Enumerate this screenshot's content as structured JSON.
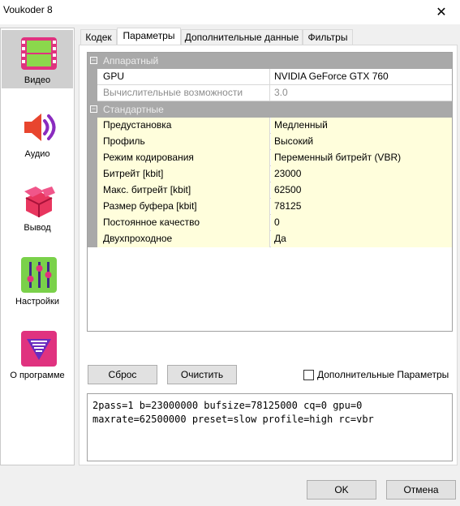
{
  "window": {
    "title": "Voukoder 8",
    "close_glyph": "✕"
  },
  "sidebar": {
    "items": [
      {
        "label": "Видео",
        "icon": "film-strip-icon",
        "active": true
      },
      {
        "label": "Аудио",
        "icon": "speaker-icon",
        "active": false
      },
      {
        "label": "Вывод",
        "icon": "package-box-icon",
        "active": false
      },
      {
        "label": "Настройки",
        "icon": "sliders-icon",
        "active": false
      },
      {
        "label": "О программе",
        "icon": "voukoder-logo-icon",
        "active": false
      }
    ]
  },
  "tabs": [
    {
      "label": "Кодек",
      "active": false
    },
    {
      "label": "Параметры",
      "active": true
    },
    {
      "label": "Дополнительные данные",
      "active": false
    },
    {
      "label": "Фильтры",
      "active": false
    }
  ],
  "property_grid": {
    "categories": [
      {
        "name": "Аппаратный",
        "toggle": "−",
        "rows": [
          {
            "name": "GPU",
            "value": "NVIDIA GeForce GTX 760",
            "highlight": false,
            "disabled": false
          },
          {
            "name": "Вычислительные возможности",
            "value": "3.0",
            "highlight": false,
            "disabled": true
          }
        ]
      },
      {
        "name": "Стандартные",
        "toggle": "−",
        "rows": [
          {
            "name": "Предустановка",
            "value": "Медленный",
            "highlight": true,
            "disabled": false
          },
          {
            "name": "Профиль",
            "value": "Высокий",
            "highlight": true,
            "disabled": false
          },
          {
            "name": "Режим кодирования",
            "value": "Переменный битрейт (VBR)",
            "highlight": true,
            "disabled": false
          },
          {
            "name": "Битрейт [kbit]",
            "value": "23000",
            "highlight": true,
            "disabled": false
          },
          {
            "name": "Макс. битрейт [kbit]",
            "value": "62500",
            "highlight": true,
            "disabled": false
          },
          {
            "name": "Размер буфера [kbit]",
            "value": "78125",
            "highlight": true,
            "disabled": false
          },
          {
            "name": "Постоянное качество",
            "value": "0",
            "highlight": true,
            "disabled": false
          },
          {
            "name": "Двухпроходное",
            "value": "Да",
            "highlight": true,
            "disabled": false
          }
        ]
      }
    ]
  },
  "actions": {
    "reset_label": "Сброс",
    "clear_label": "Очистить",
    "advanced_params_label": "Дополнительные Параметры",
    "advanced_params_checked": false
  },
  "command_line": "2pass=1 b=23000000 bufsize=78125000 cq=0 gpu=0\nmaxrate=62500000 preset=slow profile=high rc=vbr",
  "footer": {
    "ok_label": "OK",
    "cancel_label": "Отмена"
  },
  "colors": {
    "highlight_row": "#fffedc",
    "category_bg": "#a9a9a9",
    "selected_sidebar": "#cfcfcf"
  }
}
